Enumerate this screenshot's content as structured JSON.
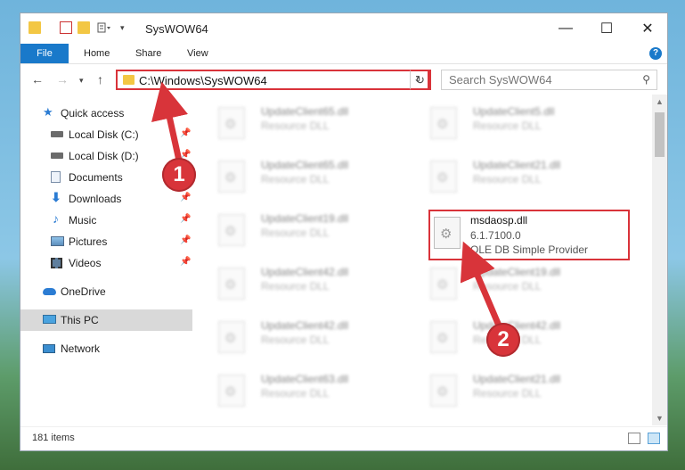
{
  "window": {
    "title": "SysWOW64",
    "controls": {
      "minimize": "—",
      "maximize": "☐",
      "close": "✕"
    }
  },
  "ribbon": {
    "tabs": [
      "File",
      "Home",
      "Share",
      "View"
    ],
    "help": "?"
  },
  "nav": {
    "address": "C:\\Windows\\SysWOW64",
    "search_placeholder": "Search SysWOW64"
  },
  "sidebar": {
    "items": [
      {
        "label": "Quick access",
        "icon": "star-icon",
        "color": "#2b7cd3"
      },
      {
        "label": "Local Disk (C:)",
        "icon": "drive-icon",
        "pinned": true
      },
      {
        "label": "Local Disk (D:)",
        "icon": "drive-icon",
        "pinned": true
      },
      {
        "label": "Documents",
        "icon": "documents-icon",
        "pinned": true
      },
      {
        "label": "Downloads",
        "icon": "download-icon",
        "pinned": true
      },
      {
        "label": "Music",
        "icon": "music-icon",
        "pinned": true
      },
      {
        "label": "Pictures",
        "icon": "pictures-icon",
        "pinned": true
      },
      {
        "label": "Videos",
        "icon": "videos-icon",
        "pinned": true
      },
      {
        "label": "OneDrive",
        "icon": "cloud-icon"
      },
      {
        "label": "This PC",
        "icon": "computer-icon",
        "selected": true
      },
      {
        "label": "Network",
        "icon": "network-icon"
      }
    ]
  },
  "files": [
    {
      "name": "UpdateClient65.dll",
      "type": "Resource DLL"
    },
    {
      "name": "UpdateClient5.dll",
      "type": "Resource DLL"
    },
    {
      "name": "UpdateClient65.dll",
      "type": "Resource DLL"
    },
    {
      "name": "UpdateClient21.dll",
      "type": "Resource DLL"
    },
    {
      "name": "UpdateClient19.dll",
      "type": "Resource DLL"
    },
    {
      "name": "UpdateClient42.dll",
      "type": "Resource DLL"
    },
    {
      "name": "UpdateClient19.dll",
      "type": "Resource DLL"
    },
    {
      "name": "UpdateClient42.dll",
      "type": "Resource DLL"
    },
    {
      "name": "UpdateClient42.dll",
      "type": "Resource DLL"
    },
    {
      "name": "UpdateClient63.dll",
      "type": "Resource DLL"
    },
    {
      "name": "UpdateClient21.dll",
      "type": "Resource DLL"
    }
  ],
  "highlighted_file": {
    "name": "msdaosp.dll",
    "version": "6.1.7100.0",
    "description": "OLE DB Simple Provider"
  },
  "status": {
    "item_count": "181 items"
  },
  "annotations": {
    "badge1": "1",
    "badge2": "2",
    "color": "#d8343a"
  }
}
